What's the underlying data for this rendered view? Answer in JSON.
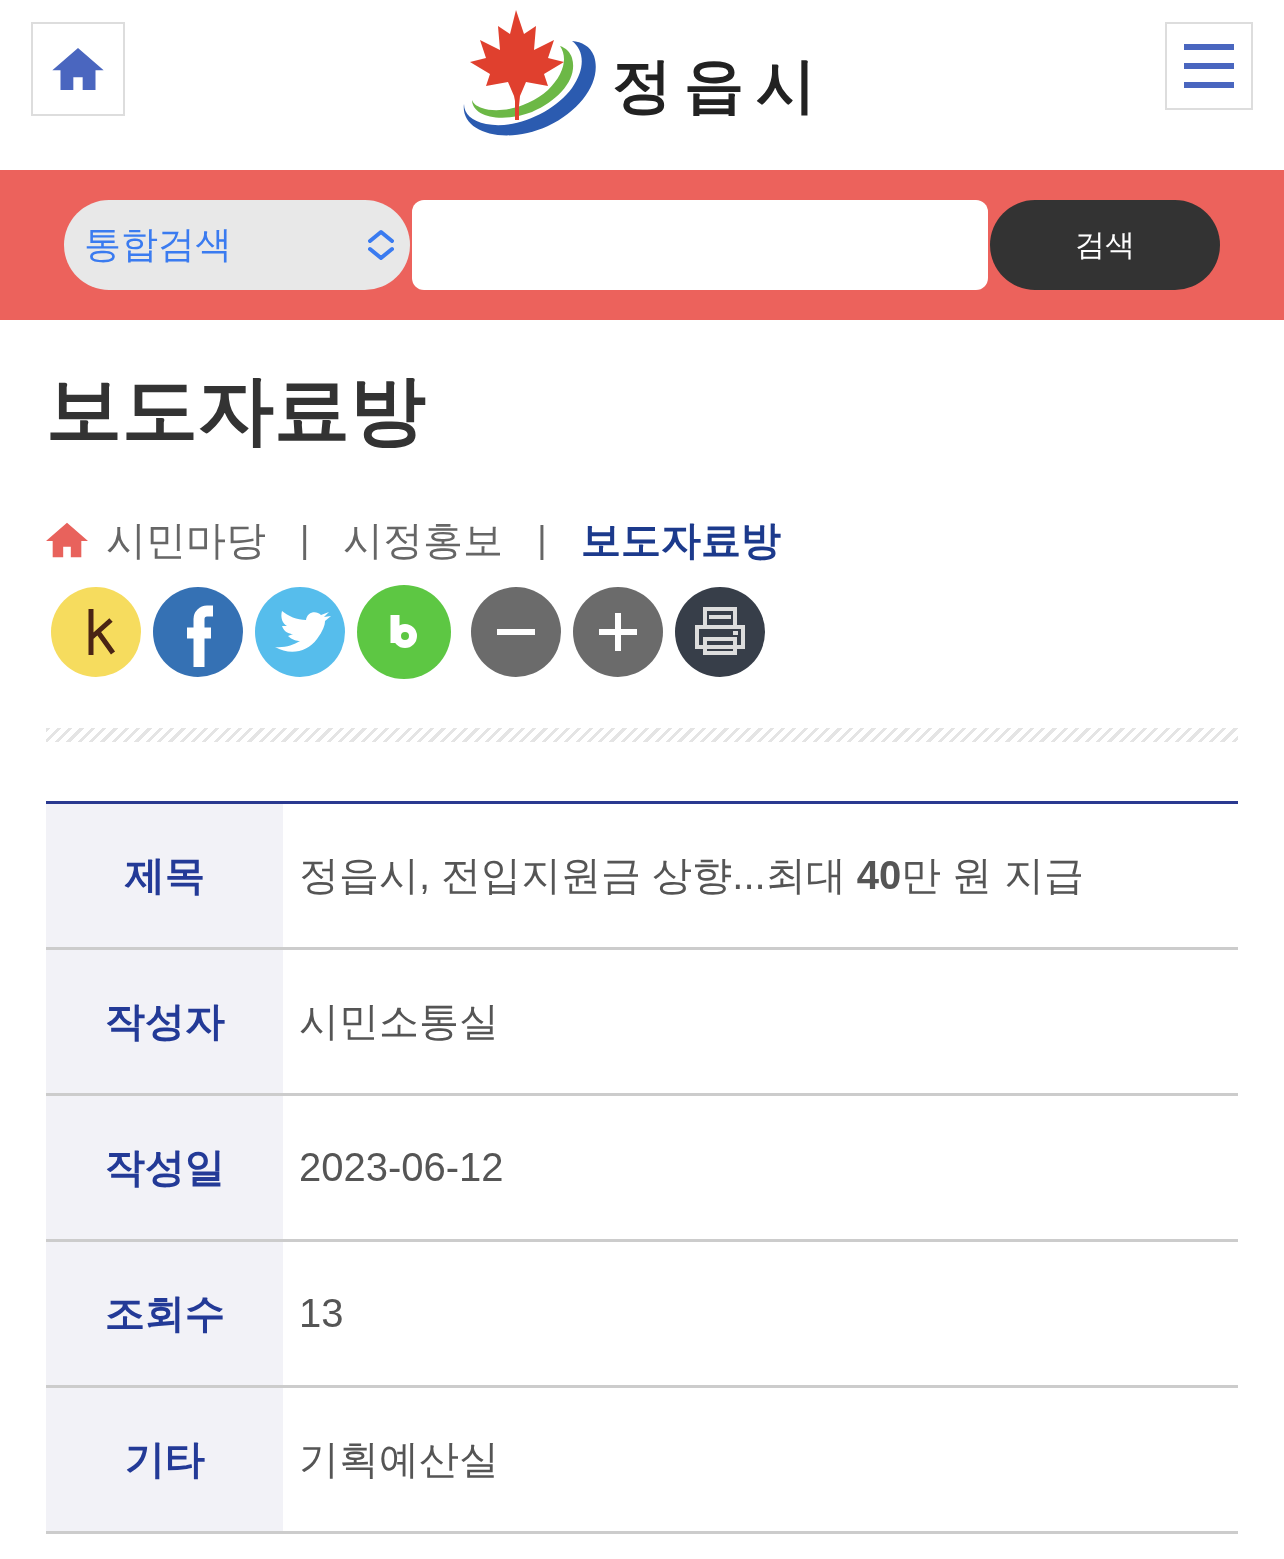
{
  "header": {
    "logo_text": "정읍시"
  },
  "search": {
    "scope": "통합검색",
    "button": "검색"
  },
  "page_title": "보도자료방",
  "breadcrumb": {
    "items": [
      {
        "label": "시민마당",
        "current": false
      },
      {
        "label": "시정홍보",
        "current": false
      },
      {
        "label": "보도자료방",
        "current": true
      }
    ],
    "separators": [
      "|",
      "|"
    ]
  },
  "details": [
    {
      "label": "제목",
      "value": "정읍시, 전입지원금 상향...최대 **40**만 원 지급"
    },
    {
      "label": "작성자",
      "value": "시민소통실"
    },
    {
      "label": "작성일",
      "value": "2023-06-12"
    },
    {
      "label": "조회수",
      "value": "13"
    },
    {
      "label": "기타",
      "value": "기획예산실"
    }
  ]
}
